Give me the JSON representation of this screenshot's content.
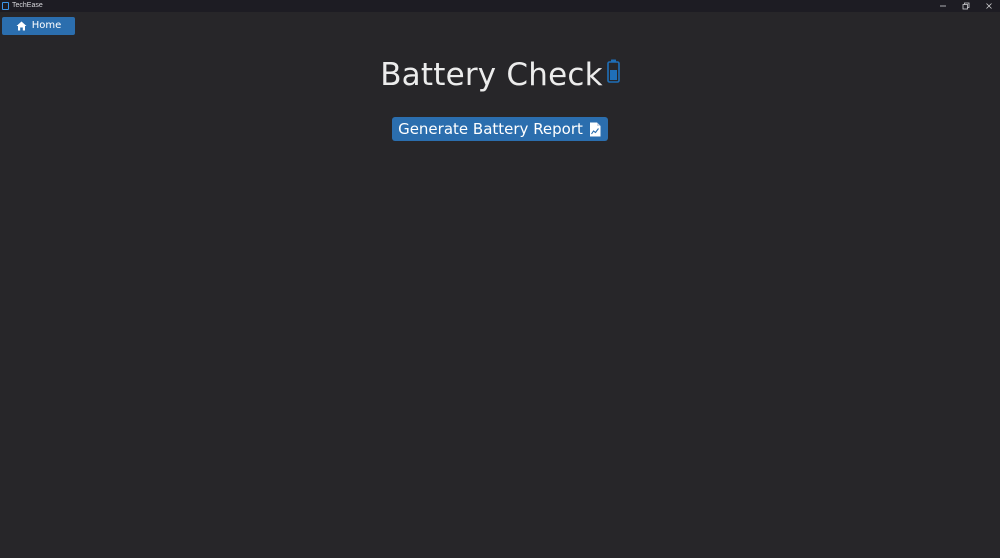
{
  "window": {
    "title": "TechEase",
    "controls": [
      "minimize-icon",
      "restore-icon",
      "close-icon"
    ]
  },
  "nav": {
    "home_label": "Home",
    "home_icon": "home-icon"
  },
  "main": {
    "title": "Battery Check",
    "title_icon": "battery-icon",
    "report_button_label": "Generate Battery Report",
    "report_button_icon": "report-icon"
  },
  "colors": {
    "background": "#272629",
    "titlebar": "#1d1c23",
    "accent": "#2b6eae",
    "battery_fill": "#1f6fb8"
  }
}
